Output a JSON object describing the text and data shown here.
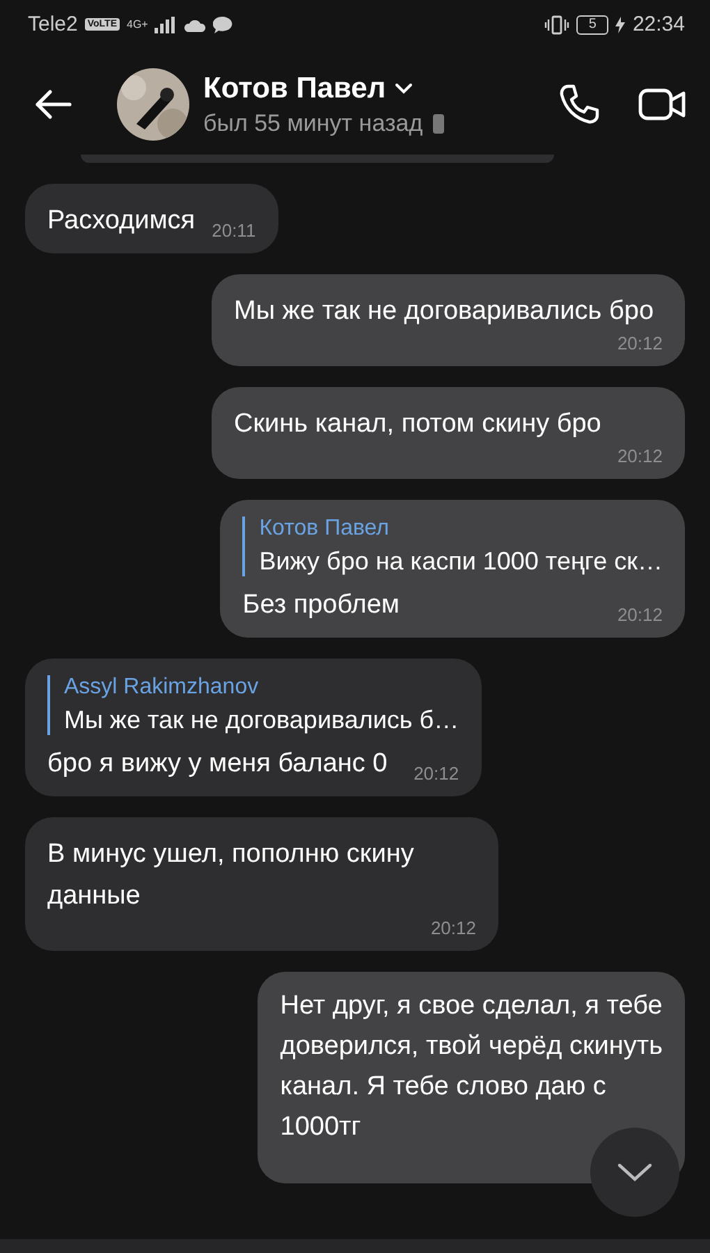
{
  "status_bar": {
    "carrier": "Tele2",
    "volte": "VoLTE",
    "network": "4G+",
    "battery": "5",
    "time": "22:34"
  },
  "header": {
    "name": "Котов Павел",
    "status": "был 55 минут назад"
  },
  "messages": [
    {
      "kind": "partial"
    },
    {
      "kind": "text",
      "outgoing": false,
      "text": "Расходимся",
      "time": "20:11"
    },
    {
      "kind": "text",
      "outgoing": true,
      "text": "Мы же так не договаривались бро",
      "time": "20:12"
    },
    {
      "kind": "text",
      "outgoing": true,
      "text": "Скинь канал, потом скину бро",
      "time": "20:12"
    },
    {
      "kind": "reply",
      "outgoing": true,
      "reply_author": "Котов Павел",
      "reply_text": "Вижу бро на каспи 1000 теңге ск…",
      "text": "Без проблем",
      "time": "20:12"
    },
    {
      "kind": "reply",
      "outgoing": false,
      "reply_author": "Assyl Rakimzhanov",
      "reply_text": "Мы же так не договаривались б…",
      "text": "бро я вижу у меня баланс 0",
      "time": "20:12"
    },
    {
      "kind": "text",
      "outgoing": false,
      "text": "В минус ушел, пополню скину данные",
      "time": "20:12"
    },
    {
      "kind": "lines",
      "outgoing": true,
      "lines": [
        "Нет друг, я свое сделал, я тебе",
        "доверился, твой черёд скинуть",
        "канал. Я тебе слово даю с",
        "1000тг"
      ]
    }
  ]
}
